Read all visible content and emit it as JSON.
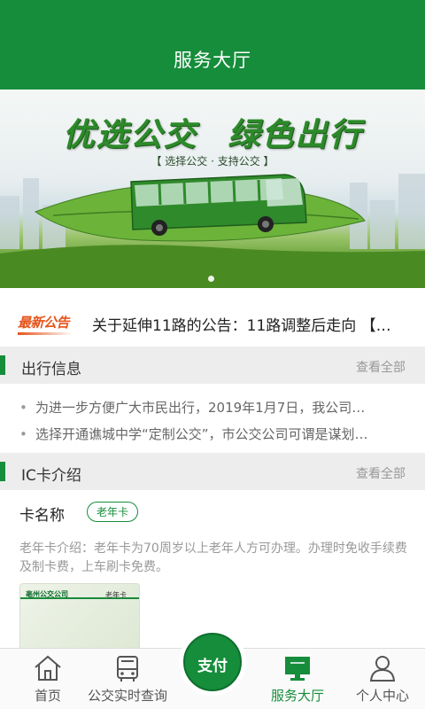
{
  "header": {
    "title": "服务大厅"
  },
  "banner": {
    "slogan_left": "优选公交",
    "slogan_right": "绿色出行",
    "subtitle": "【 选择公交 · 支持公交 】"
  },
  "notice": {
    "badge": "最新公告",
    "text": "关于延伸11路的公告：11路调整后走向 【…"
  },
  "travel": {
    "title": "出行信息",
    "more": "查看全部",
    "items": [
      "为进一步方便广大市民出行，2019年1月7日，我公司…",
      "选择开通谯城中学“定制公交”，市公交公司可谓是谋划…"
    ]
  },
  "ic": {
    "title": "IC卡介绍",
    "more": "查看全部",
    "card_name_label": "卡名称",
    "card_tag": "老年卡",
    "description": "老年卡介绍：老年卡为70周岁以上老年人方可办理。办理时免收手续费及制卡费，上车刷卡免费。",
    "card_image": {
      "company": "亳州公交公司",
      "type": "老年卡"
    }
  },
  "tabbar": {
    "items": [
      {
        "label": "首页",
        "icon": "home-icon"
      },
      {
        "label": "公交实时查询",
        "icon": "bus-icon"
      },
      {
        "label": "服务大厅",
        "icon": "monitor-icon",
        "active": true
      },
      {
        "label": "个人中心",
        "icon": "person-icon"
      }
    ],
    "pay_label": "支付"
  },
  "colors": {
    "brand": "#158d3b",
    "notice": "#e5541b"
  }
}
